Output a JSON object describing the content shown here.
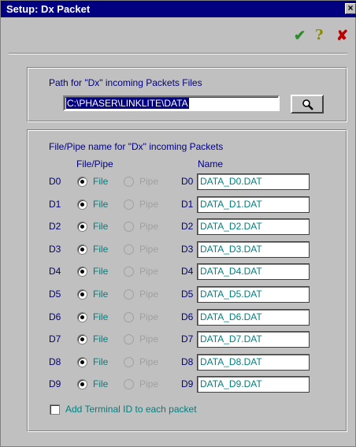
{
  "window": {
    "title": "Setup: Dx Packet",
    "close_glyph": "×"
  },
  "toolbar": {
    "ok_glyph": "✔",
    "ok_icon": "green-check-icon",
    "help_glyph": "?",
    "help_icon": "question-icon",
    "cancel_glyph": "✘",
    "cancel_icon": "red-x-icon"
  },
  "path_group": {
    "label": "Path for \"Dx\" incoming Packets Files",
    "value": "C:\\PHASER\\LINKLITE\\DATA",
    "browse_icon": "magnifier-icon"
  },
  "packets_group": {
    "label": "File/Pipe name for \"Dx\" incoming Packets",
    "col_file_pipe": "File/Pipe",
    "col_name": "Name",
    "file_label": "File",
    "pipe_label": "Pipe",
    "rows": [
      {
        "id": "D0",
        "name": "DATA_D0.DAT",
        "mode": "File"
      },
      {
        "id": "D1",
        "name": "DATA_D1.DAT",
        "mode": "File"
      },
      {
        "id": "D2",
        "name": "DATA_D2.DAT",
        "mode": "File"
      },
      {
        "id": "D3",
        "name": "DATA_D3.DAT",
        "mode": "File"
      },
      {
        "id": "D4",
        "name": "DATA_D4.DAT",
        "mode": "File"
      },
      {
        "id": "D5",
        "name": "DATA_D5.DAT",
        "mode": "File"
      },
      {
        "id": "D6",
        "name": "DATA_D6.DAT",
        "mode": "File"
      },
      {
        "id": "D7",
        "name": "DATA_D7.DAT",
        "mode": "File"
      },
      {
        "id": "D8",
        "name": "DATA_D8.DAT",
        "mode": "File"
      },
      {
        "id": "D9",
        "name": "DATA_D9.DAT",
        "mode": "File"
      }
    ],
    "terminal_id_label": "Add Terminal ID to each packet",
    "terminal_id_checked": false
  },
  "colors": {
    "titlebar": "#000080",
    "face": "#c0c0c0",
    "label": "#000080",
    "value_text": "#008080"
  }
}
